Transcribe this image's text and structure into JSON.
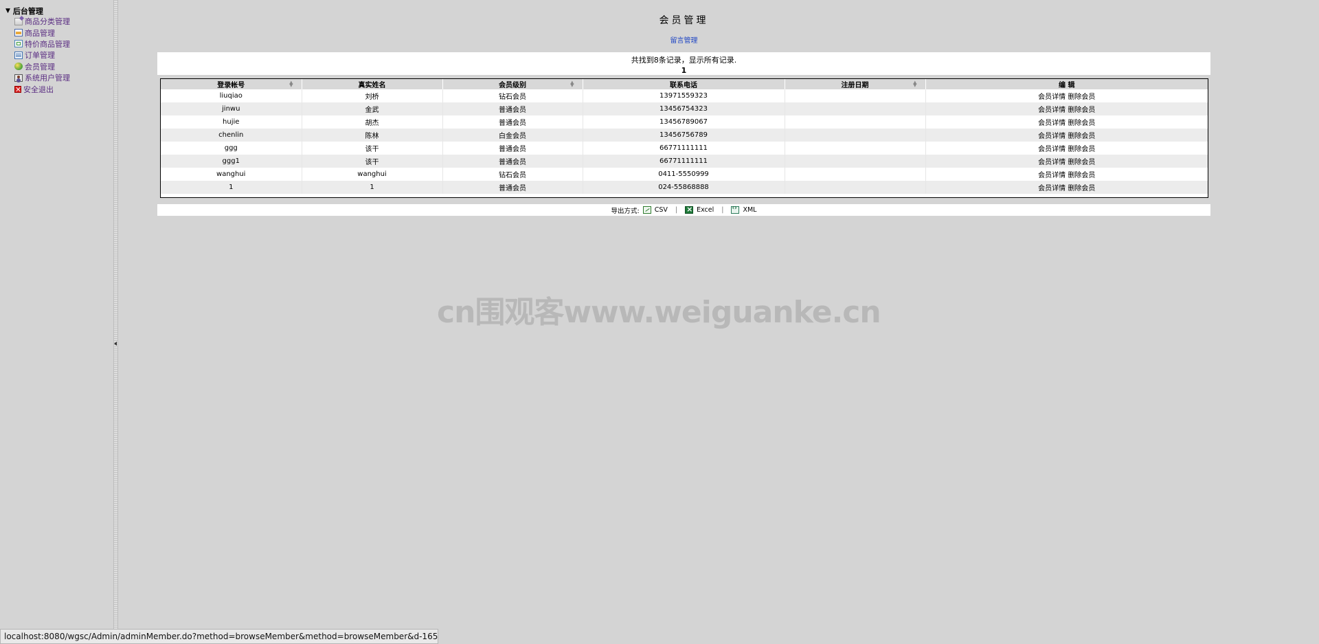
{
  "sidebar": {
    "root_label": "后台管理",
    "items": [
      {
        "label": "商品分类管理",
        "icon": "category-icon"
      },
      {
        "label": "商品管理",
        "icon": "goods-icon"
      },
      {
        "label": "特价商品管理",
        "icon": "special-goods-icon"
      },
      {
        "label": "订单管理",
        "icon": "order-icon"
      },
      {
        "label": "会员管理",
        "icon": "member-icon"
      },
      {
        "label": "系统用户管理",
        "icon": "system-user-icon"
      },
      {
        "label": "安全退出",
        "icon": "exit-icon"
      }
    ]
  },
  "main": {
    "title": "会员管理",
    "message_link": "留言管理",
    "summary": "共找到8条记录，显示所有记录.",
    "page_number": "1"
  },
  "table": {
    "headers": [
      "登录帐号",
      "真实姓名",
      "会员级别",
      "联系电话",
      "注册日期",
      "编 辑"
    ],
    "rows": [
      {
        "login": "liuqiao",
        "name": "刘桥",
        "level": "钻石会员",
        "phone": "13971559323",
        "date": "",
        "detail": "会员详情",
        "delete": "删除会员"
      },
      {
        "login": "jinwu",
        "name": "金武",
        "level": "普通会员",
        "phone": "13456754323",
        "date": "",
        "detail": "会员详情",
        "delete": "删除会员"
      },
      {
        "login": "hujie",
        "name": "胡杰",
        "level": "普通会员",
        "phone": "13456789067",
        "date": "",
        "detail": "会员详情",
        "delete": "删除会员"
      },
      {
        "login": "chenlin",
        "name": "陈林",
        "level": "白金会员",
        "phone": "13456756789",
        "date": "",
        "detail": "会员详情",
        "delete": "删除会员"
      },
      {
        "login": "ggg",
        "name": "该干",
        "level": "普通会员",
        "phone": "66771111111",
        "date": "",
        "detail": "会员详情",
        "delete": "删除会员"
      },
      {
        "login": "ggg1",
        "name": "该干",
        "level": "普通会员",
        "phone": "66771111111",
        "date": "",
        "detail": "会员详情",
        "delete": "删除会员"
      },
      {
        "login": "wanghui",
        "name": "wanghui",
        "level": "钻石会员",
        "phone": "0411-5550999",
        "date": "",
        "detail": "会员详情",
        "delete": "删除会员"
      },
      {
        "login": "1",
        "name": "1",
        "level": "普通会员",
        "phone": "024-55868888",
        "date": "",
        "detail": "会员详情",
        "delete": "删除会员"
      }
    ]
  },
  "export": {
    "label": "导出方式:",
    "csv": "CSV",
    "excel": "Excel",
    "xml": "XML",
    "separator": "|"
  },
  "watermark": "cn围观客www.weiguanke.cn",
  "status_bar": "localhost:8080/wgsc/Admin/adminMember.do?method=browseMember&method=browseMember&d-165..."
}
